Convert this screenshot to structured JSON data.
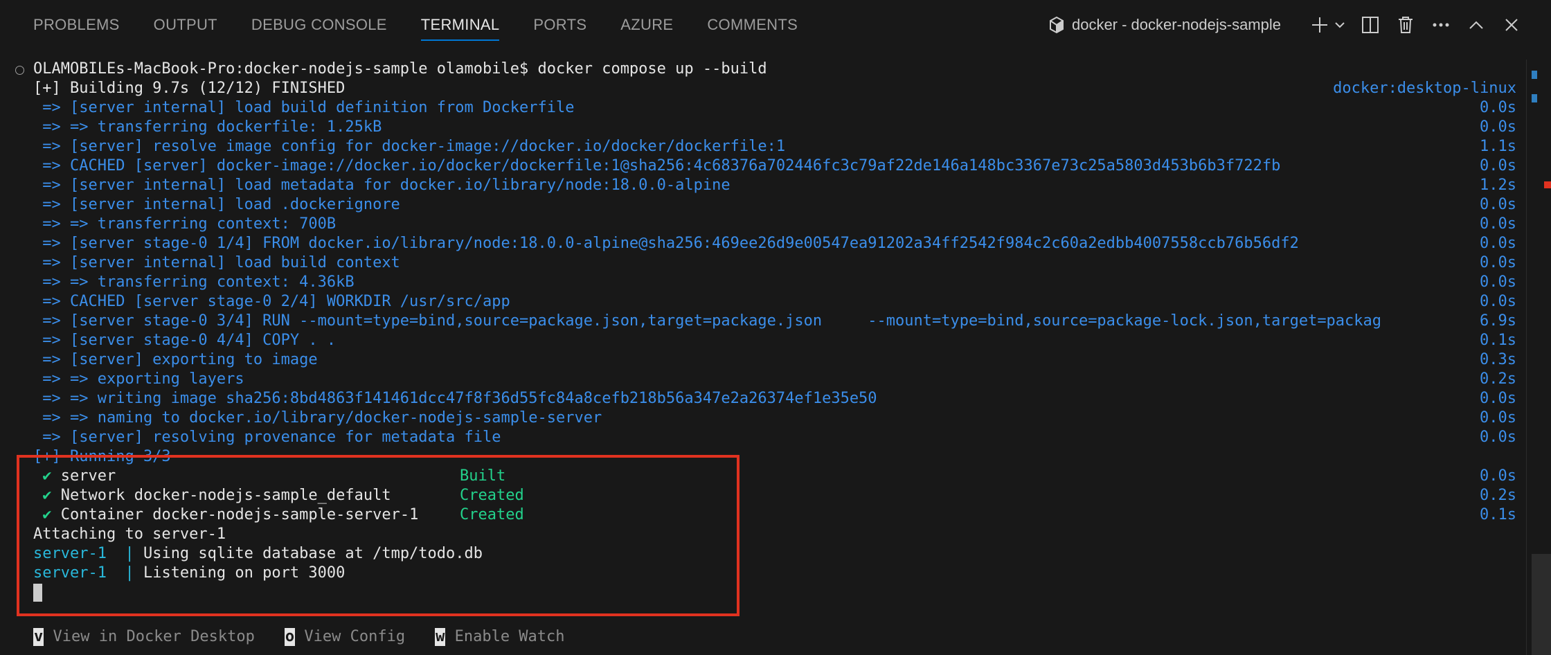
{
  "panel": {
    "tabs": [
      {
        "label": "PROBLEMS"
      },
      {
        "label": "OUTPUT"
      },
      {
        "label": "DEBUG CONSOLE"
      },
      {
        "label": "TERMINAL",
        "active": true
      },
      {
        "label": "PORTS"
      },
      {
        "label": "AZURE"
      },
      {
        "label": "COMMENTS"
      }
    ],
    "terminal_title": "docker - docker-nodejs-sample",
    "icons": [
      "docker-icon",
      "new-terminal-icon",
      "chevron-down-icon",
      "split-terminal-icon",
      "trash-icon",
      "more-icon",
      "maximize-panel-icon",
      "close-icon"
    ]
  },
  "terminal": {
    "prompt": "OLAMOBILEs-MacBook-Pro:docker-nodejs-sample olamobile$ docker compose up --build",
    "building": "[+] Building 9.7s (12/12) FINISHED",
    "builder": "docker:desktop-linux",
    "build_steps": [
      {
        "text": " => [server internal] load build definition from Dockerfile",
        "time": "0.0s"
      },
      {
        "text": " => => transferring dockerfile: 1.25kB",
        "time": "0.0s"
      },
      {
        "text": " => [server] resolve image config for docker-image://docker.io/docker/dockerfile:1",
        "time": "1.1s"
      },
      {
        "text": " => CACHED [server] docker-image://docker.io/docker/dockerfile:1@sha256:4c68376a702446fc3c79af22de146a148bc3367e73c25a5803d453b6b3f722fb",
        "time": "0.0s"
      },
      {
        "text": " => [server internal] load metadata for docker.io/library/node:18.0.0-alpine",
        "time": "1.2s"
      },
      {
        "text": " => [server internal] load .dockerignore",
        "time": "0.0s"
      },
      {
        "text": " => => transferring context: 700B",
        "time": "0.0s"
      },
      {
        "text": " => [server stage-0 1/4] FROM docker.io/library/node:18.0.0-alpine@sha256:469ee26d9e00547ea91202a34ff2542f984c2c60a2edbb4007558ccb76b56df2",
        "time": "0.0s"
      },
      {
        "text": " => [server internal] load build context",
        "time": "0.0s"
      },
      {
        "text": " => => transferring context: 4.36kB",
        "time": "0.0s"
      },
      {
        "text": " => CACHED [server stage-0 2/4] WORKDIR /usr/src/app",
        "time": "0.0s"
      },
      {
        "text": " => [server stage-0 3/4] RUN --mount=type=bind,source=package.json,target=package.json     --mount=type=bind,source=package-lock.json,target=packag",
        "time": "6.9s"
      },
      {
        "text": " => [server stage-0 4/4] COPY . .",
        "time": "0.1s"
      },
      {
        "text": " => [server] exporting to image",
        "time": "0.3s"
      },
      {
        "text": " => => exporting layers",
        "time": "0.2s"
      },
      {
        "text": " => => writing image sha256:8bd4863f141461dcc47f8f36d55fc84a8cefb218b56a347e2a26374ef1e35e50",
        "time": "0.0s"
      },
      {
        "text": " => => naming to docker.io/library/docker-nodejs-sample-server",
        "time": "0.0s"
      },
      {
        "text": " => [server] resolving provenance for metadata file",
        "time": "0.0s"
      }
    ],
    "running": "[+] Running 3/3",
    "services": [
      {
        "check": "✔",
        "name": "server",
        "status": "Built",
        "time": "0.0s"
      },
      {
        "check": "✔",
        "name": "Network docker-nodejs-sample_default",
        "status": "Created",
        "time": "0.2s"
      },
      {
        "check": "✔",
        "name": "Container docker-nodejs-sample-server-1",
        "status": "Created",
        "time": "0.1s"
      }
    ],
    "attaching": "Attaching to server-1",
    "logs": [
      {
        "prefix": "server-1  | ",
        "msg": "Using sqlite database at /tmp/todo.db"
      },
      {
        "prefix": "server-1  | ",
        "msg": "Listening on port 3000"
      }
    ]
  },
  "footer": [
    {
      "key": "v",
      "label": " View in Docker Desktop"
    },
    {
      "key": "o",
      "label": " View Config"
    },
    {
      "key": "w",
      "label": " Enable Watch"
    }
  ],
  "colors": {
    "accent": "#0078d4",
    "highlight": "#e03220",
    "ansi_blue": "#3b8eea",
    "ansi_green": "#23d18b",
    "ansi_cyan": "#29b8db"
  }
}
